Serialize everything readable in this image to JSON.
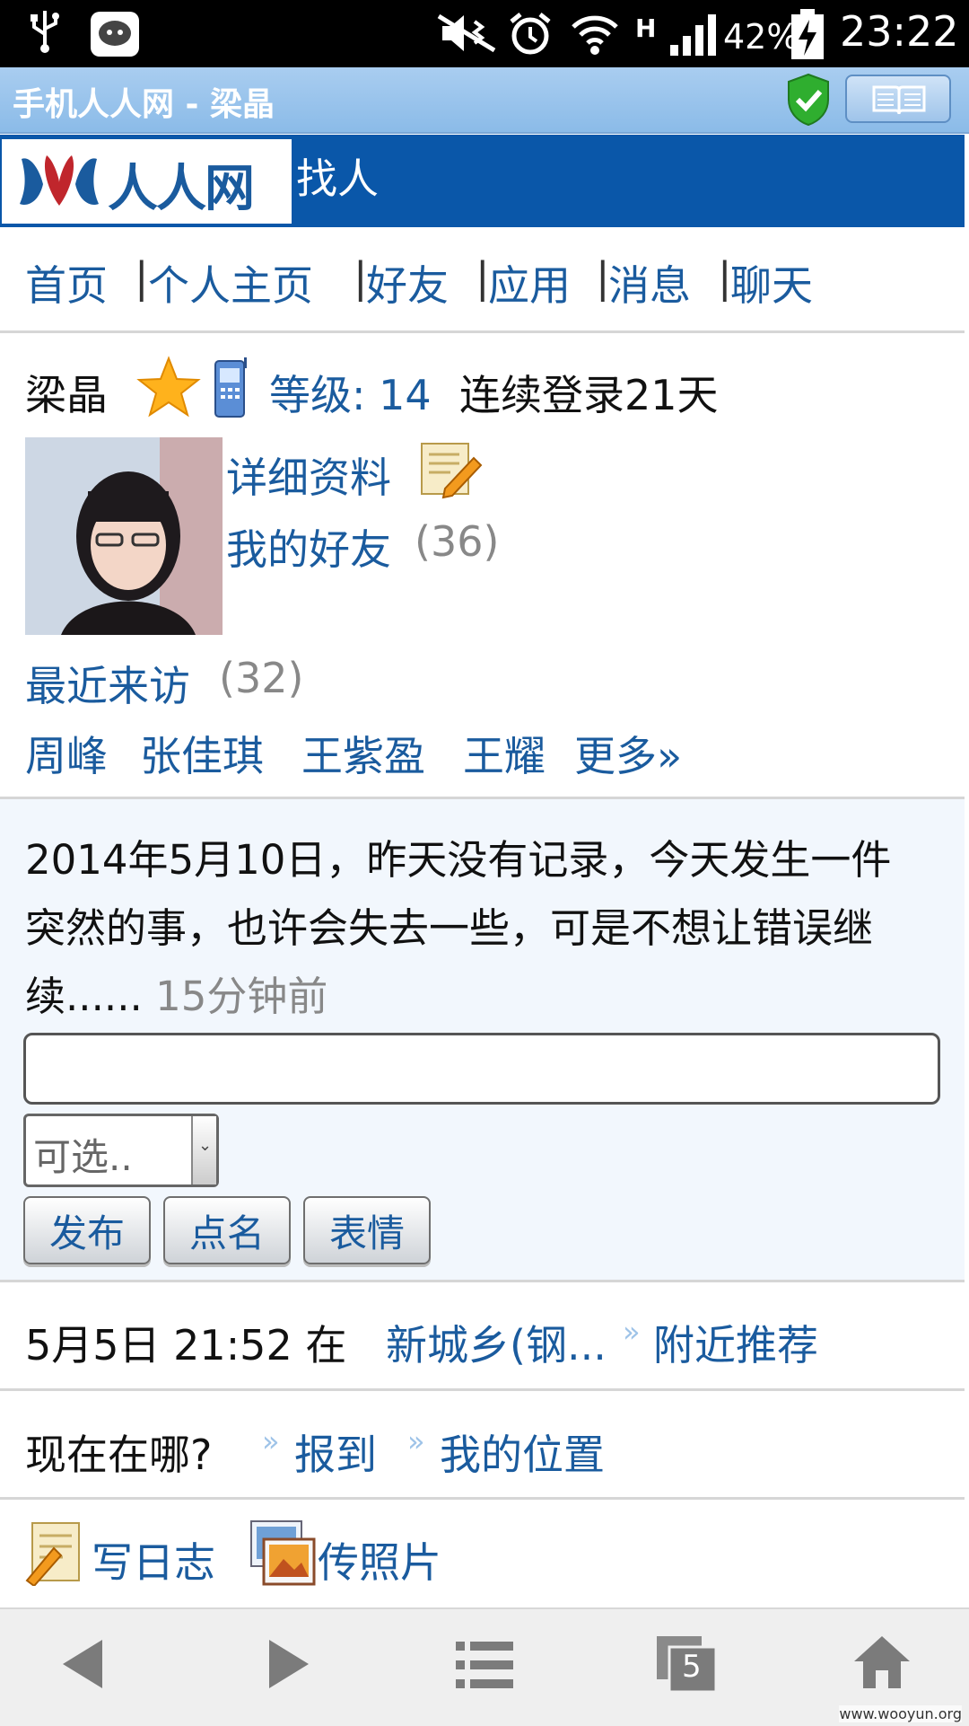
{
  "status_bar": {
    "battery": "42%",
    "time": "23:22",
    "network": "H"
  },
  "browser": {
    "title": "手机人人网 - 梁晶"
  },
  "header": {
    "logo": "人人网",
    "page_title": "找人"
  },
  "nav": [
    "首页",
    "个人主页",
    "好友",
    "应用",
    "消息",
    "聊天"
  ],
  "profile": {
    "name": "梁晶",
    "level_label": "等级: 14",
    "login_streak": "连续登录21天",
    "details_link": "详细资料",
    "friends_link": "我的好友",
    "friends_count": "(36)"
  },
  "visitors": {
    "label": "最近来访",
    "count": "(32)",
    "names": [
      "周峰",
      "张佳琪",
      "王紫盈",
      "王耀"
    ],
    "more": "更多»"
  },
  "status_post": {
    "text": "2014年5月10日，昨天没有记录，今天发生一件突然的事，也许会失去一些，可是不想让错误继续......",
    "time_ago": "15分钟前",
    "input_value": "",
    "select_value": "可选..",
    "buttons": [
      "发布",
      "点名",
      "表情"
    ]
  },
  "checkin": {
    "date_prefix": "5月5日 21:52 在",
    "place": "新城乡(钢...",
    "nearby": "附近推荐"
  },
  "location": {
    "question": "现在在哪?",
    "checkin_link": "报到",
    "my_location_link": "我的位置"
  },
  "actions": {
    "write_diary": "写日志",
    "upload_photo": "传照片"
  },
  "bottom_bar": {
    "tabs_count": "5"
  },
  "watermark": "www.wooyun.org",
  "colors": {
    "link": "#1a5b9e",
    "header_blue": "#0a57a9",
    "title_bar": "#8bbbe8"
  }
}
